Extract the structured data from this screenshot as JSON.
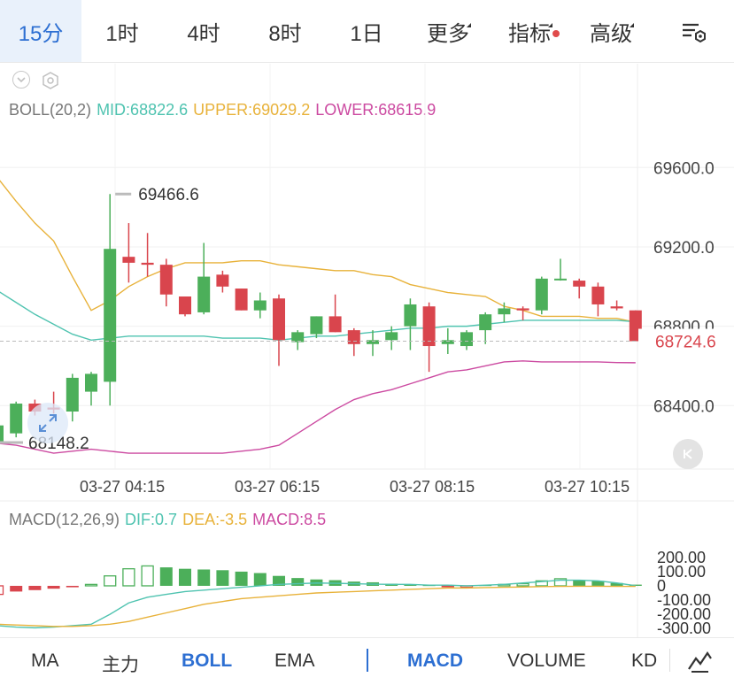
{
  "timeframes": [
    {
      "label": "15分",
      "active": true,
      "tri": false,
      "dot": false
    },
    {
      "label": "1时",
      "active": false,
      "tri": false,
      "dot": false
    },
    {
      "label": "4时",
      "active": false,
      "tri": false,
      "dot": false
    },
    {
      "label": "8时",
      "active": false,
      "tri": false,
      "dot": false
    },
    {
      "label": "1日",
      "active": false,
      "tri": false,
      "dot": false
    },
    {
      "label": "更多",
      "active": false,
      "tri": true,
      "dot": false
    },
    {
      "label": "指标",
      "active": false,
      "tri": true,
      "dot": true
    },
    {
      "label": "高级",
      "active": false,
      "tri": true,
      "dot": false
    }
  ],
  "boll": {
    "name": "BOLL(20,2)",
    "mid": "MID:68822.6",
    "upper": "UPPER:69029.2",
    "lower": "LOWER:68615.9"
  },
  "price_axis": [
    "69600.0",
    "69200.0",
    "68800.0",
    "68400.0"
  ],
  "current_price": "68724.6",
  "high_label": "69466.6",
  "low_label": "68148.2",
  "time_axis": [
    "03-27 04:15",
    "03-27 06:15",
    "03-27 08:15",
    "03-27 10:15"
  ],
  "macd": {
    "name": "MACD(12,26,9)",
    "dif": "DIF:0.7",
    "dea": "DEA:-3.5",
    "macd": "MACD:8.5"
  },
  "macd_axis": [
    "200.00",
    "100.00",
    "0",
    "-100.00",
    "-200.00",
    "-300.00"
  ],
  "bottom_tabs": [
    {
      "label": "MA",
      "active": false
    },
    {
      "label": "主力",
      "active": false
    },
    {
      "label": "BOLL",
      "active": true
    },
    {
      "label": "EMA",
      "active": false
    },
    {
      "label": "MACD",
      "active": true
    },
    {
      "label": "VOLUME",
      "active": false
    },
    {
      "label": "KD",
      "active": false
    }
  ],
  "colors": {
    "up": "#4caf5a",
    "down": "#d9454d",
    "mid": "#4fc3b0",
    "upper": "#e8b23a",
    "lower": "#cc4aa1",
    "accent": "#2d6fd2"
  },
  "chart_data": {
    "type": "candlestick",
    "title": "",
    "xlabel": "",
    "ylabel": "",
    "ylim": [
      68080,
      69820
    ],
    "candles": [
      {
        "o": 68210,
        "h": 68310,
        "l": 68170,
        "c": 68300
      },
      {
        "o": 68260,
        "h": 68420,
        "l": 68240,
        "c": 68410
      },
      {
        "o": 68410,
        "h": 68430,
        "l": 68350,
        "c": 68370
      },
      {
        "o": 68390,
        "h": 68470,
        "l": 68360,
        "c": 68380
      },
      {
        "o": 68370,
        "h": 68560,
        "l": 68320,
        "c": 68540
      },
      {
        "o": 68470,
        "h": 68570,
        "l": 68400,
        "c": 68560
      },
      {
        "o": 68520,
        "h": 69466.6,
        "l": 68400,
        "c": 69190
      },
      {
        "o": 69150,
        "h": 69320,
        "l": 69020,
        "c": 69120
      },
      {
        "o": 69120,
        "h": 69270,
        "l": 69050,
        "c": 69110
      },
      {
        "o": 69110,
        "h": 69140,
        "l": 68900,
        "c": 68960
      },
      {
        "o": 68950,
        "h": 68950,
        "l": 68850,
        "c": 68860
      },
      {
        "o": 68870,
        "h": 69220,
        "l": 68860,
        "c": 69050
      },
      {
        "o": 69060,
        "h": 69080,
        "l": 68970,
        "c": 69000
      },
      {
        "o": 68990,
        "h": 68990,
        "l": 68880,
        "c": 68880
      },
      {
        "o": 68880,
        "h": 68970,
        "l": 68840,
        "c": 68930
      },
      {
        "o": 68940,
        "h": 68960,
        "l": 68600,
        "c": 68730
      },
      {
        "o": 68720,
        "h": 68780,
        "l": 68680,
        "c": 68770
      },
      {
        "o": 68760,
        "h": 68850,
        "l": 68740,
        "c": 68850
      },
      {
        "o": 68850,
        "h": 68960,
        "l": 68770,
        "c": 68770
      },
      {
        "o": 68780,
        "h": 68790,
        "l": 68650,
        "c": 68710
      },
      {
        "o": 68710,
        "h": 68780,
        "l": 68650,
        "c": 68730
      },
      {
        "o": 68730,
        "h": 68800,
        "l": 68680,
        "c": 68770
      },
      {
        "o": 68800,
        "h": 68940,
        "l": 68680,
        "c": 68910
      },
      {
        "o": 68900,
        "h": 68920,
        "l": 68570,
        "c": 68700
      },
      {
        "o": 68710,
        "h": 68790,
        "l": 68660,
        "c": 68730
      },
      {
        "o": 68700,
        "h": 68780,
        "l": 68680,
        "c": 68770
      },
      {
        "o": 68780,
        "h": 68870,
        "l": 68710,
        "c": 68860
      },
      {
        "o": 68860,
        "h": 68920,
        "l": 68820,
        "c": 68890
      },
      {
        "o": 68890,
        "h": 68900,
        "l": 68830,
        "c": 68880
      },
      {
        "o": 68880,
        "h": 69050,
        "l": 68860,
        "c": 69040
      },
      {
        "o": 69040,
        "h": 69140,
        "l": 69030,
        "c": 69040
      },
      {
        "o": 69030,
        "h": 69040,
        "l": 68940,
        "c": 69000
      },
      {
        "o": 69000,
        "h": 69020,
        "l": 68850,
        "c": 68910
      },
      {
        "o": 68900,
        "h": 68930,
        "l": 68880,
        "c": 68890
      },
      {
        "o": 68880,
        "h": 68880,
        "l": 68870,
        "c": 68724.6
      }
    ],
    "boll_upper": [
      69550,
      69430,
      69320,
      69230,
      69050,
      68880,
      68930,
      69000,
      69050,
      69090,
      69120,
      69120,
      69120,
      69130,
      69130,
      69110,
      69100,
      69090,
      69080,
      69080,
      69060,
      69050,
      69010,
      68990,
      68970,
      68960,
      68950,
      68900,
      68880,
      68850,
      68850,
      68850,
      68840,
      68840,
      68820
    ],
    "boll_mid": [
      68980,
      68920,
      68860,
      68810,
      68760,
      68730,
      68740,
      68750,
      68750,
      68750,
      68750,
      68750,
      68740,
      68740,
      68740,
      68730,
      68740,
      68750,
      68750,
      68760,
      68770,
      68780,
      68790,
      68790,
      68800,
      68800,
      68810,
      68820,
      68830,
      68830,
      68830,
      68830,
      68830,
      68830,
      68822.6
    ],
    "boll_lower": [
      68210,
      68200,
      68180,
      68160,
      68170,
      68180,
      68170,
      68160,
      68160,
      68160,
      68160,
      68160,
      68160,
      68170,
      68180,
      68200,
      68260,
      68320,
      68380,
      68430,
      68460,
      68480,
      68510,
      68540,
      68570,
      68580,
      68600,
      68620,
      68625,
      68620,
      68620,
      68620,
      68620,
      68617,
      68615.9
    ],
    "macd_ylim": [
      -330,
      230
    ],
    "macd_hist": [
      -60,
      -40,
      -30,
      -20,
      -10,
      10,
      70,
      120,
      140,
      130,
      120,
      115,
      110,
      100,
      90,
      70,
      55,
      45,
      40,
      30,
      25,
      15,
      10,
      5,
      -5,
      -10,
      5,
      10,
      15,
      35,
      50,
      40,
      35,
      20,
      8.5
    ],
    "dif": [
      -280,
      -290,
      -295,
      -290,
      -280,
      -270,
      -200,
      -120,
      -80,
      -60,
      -40,
      -30,
      -20,
      -10,
      0,
      10,
      15,
      20,
      18,
      15,
      12,
      10,
      10,
      5,
      5,
      0,
      5,
      10,
      20,
      30,
      40,
      40,
      35,
      20,
      0.7
    ],
    "dea": [
      -270,
      -275,
      -280,
      -285,
      -285,
      -280,
      -270,
      -250,
      -220,
      -190,
      -160,
      -130,
      -110,
      -90,
      -80,
      -70,
      -60,
      -50,
      -45,
      -40,
      -35,
      -30,
      -25,
      -20,
      -15,
      -15,
      -12,
      -10,
      -8,
      -5,
      -4,
      -3,
      -3,
      -3.5,
      -3.5
    ]
  }
}
